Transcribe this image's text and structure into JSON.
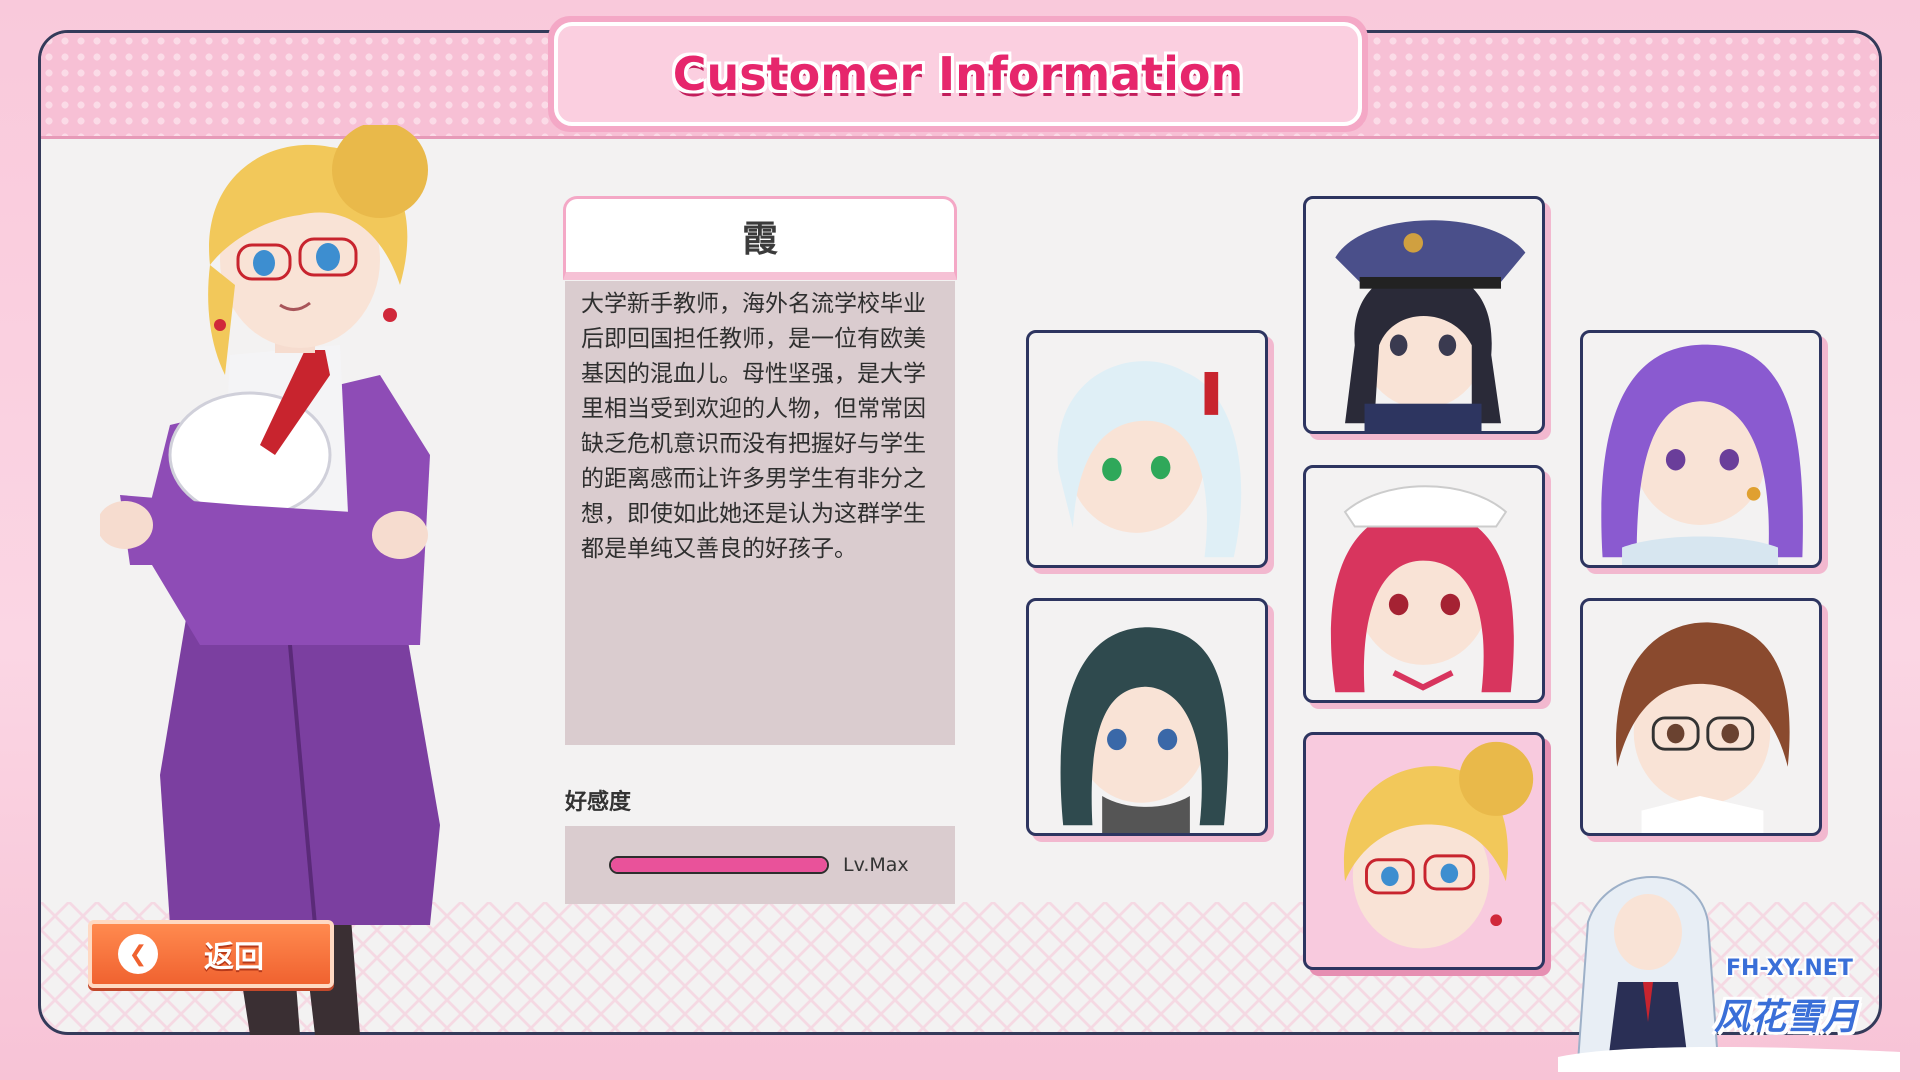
{
  "header": {
    "title": "Customer Information"
  },
  "customer": {
    "name": "霞",
    "description": "大学新手教师，海外名流学校毕业后即回国担任教师，是一位有欧美基因的混血儿。母性坚强，是大学里相当受到欢迎的人物，但常常因缺乏危机意识而没有把握好与学生的距离感而让许多男学生有非分之想，即使如此她还是认为这群学生都是单纯又善良的好孩子。",
    "affection_label": "好感度",
    "affection_level_text": "Lv.Max",
    "affection_fill": 1.0
  },
  "back_button": {
    "label": "返回",
    "icon": "arrow-left-icon"
  },
  "portraits": [
    {
      "id": "white-hair",
      "hair": "#dfeff6",
      "eyes": "#2fa85a",
      "selected": false
    },
    {
      "id": "police",
      "hair": "#2a2a38",
      "eyes": "#3a3a50",
      "selected": false
    },
    {
      "id": "purple-hair",
      "hair": "#8a5ad0",
      "eyes": "#6a3e9a",
      "selected": false
    },
    {
      "id": "maid",
      "hair": "#d8355e",
      "eyes": "#a52233",
      "selected": false
    },
    {
      "id": "teal-hair",
      "hair": "#2f4a4e",
      "eyes": "#3a68a8",
      "selected": false
    },
    {
      "id": "brown-glasses",
      "hair": "#8a4a2e",
      "eyes": "#6a4230",
      "selected": false
    },
    {
      "id": "blonde-teacher",
      "hair": "#f2c85a",
      "eyes": "#3d8ed0",
      "selected": true
    }
  ],
  "watermark": {
    "url": "FH-XY.NET",
    "text": "风花雪月"
  },
  "colors": {
    "accent": "#e6266c",
    "bar": "#e9529a",
    "button": "#f06230"
  }
}
